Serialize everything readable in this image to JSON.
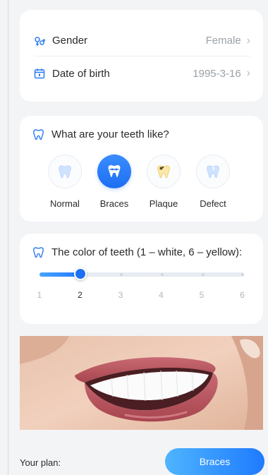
{
  "profile": {
    "gender": {
      "label": "Gender",
      "value": "Female",
      "icon": "gender-icon"
    },
    "dob": {
      "label": "Date of birth",
      "value": "1995-3-16",
      "icon": "calendar-icon"
    }
  },
  "teeth": {
    "title": "What are your teeth like?",
    "options": [
      {
        "label": "Normal",
        "icon": "tooth-normal-icon",
        "selected": false
      },
      {
        "label": "Braces",
        "icon": "tooth-braces-icon",
        "selected": true
      },
      {
        "label": "Plaque",
        "icon": "tooth-plaque-icon",
        "selected": false
      },
      {
        "label": "Defect",
        "icon": "tooth-defect-icon",
        "selected": false
      }
    ]
  },
  "color": {
    "title": "The color of teeth (1 – white, 6 – yellow):",
    "value": 2,
    "min": 1,
    "max": 6,
    "ticks": [
      "1",
      "2",
      "3",
      "4",
      "5",
      "6"
    ]
  },
  "plan": {
    "label": "Your plan:",
    "button": "Braces"
  },
  "colors": {
    "accent": "#1f6ff4",
    "accent_light": "#4fb4ff",
    "background": "#f3f4f6",
    "card": "#ffffff",
    "muted": "#9aa0a6"
  }
}
